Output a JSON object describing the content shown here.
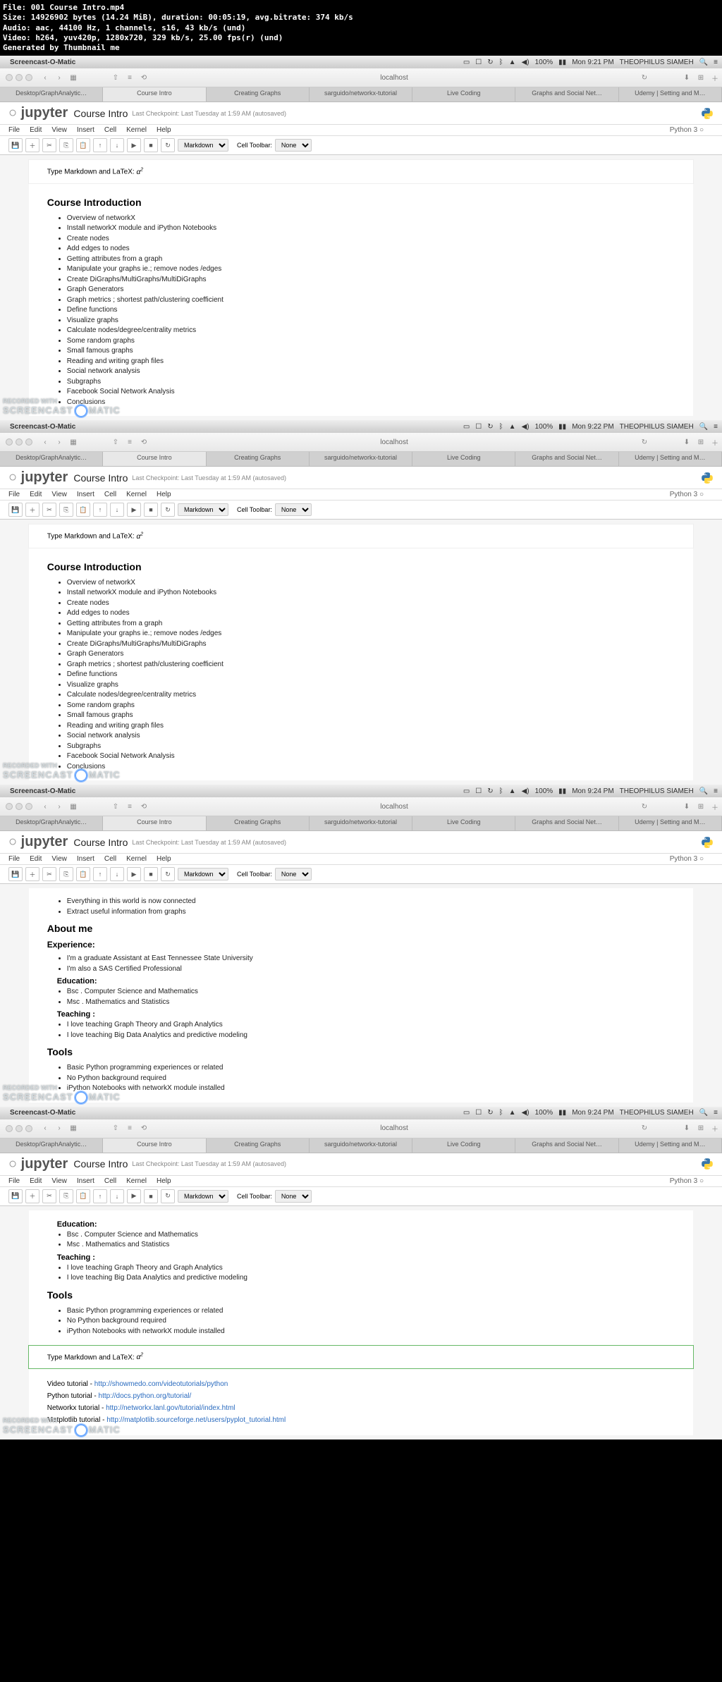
{
  "meta": {
    "l1": "File: 001 Course Intro.mp4",
    "l2": "Size: 14926902 bytes (14.24 MiB), duration: 00:05:19, avg.bitrate: 374 kb/s",
    "l3": "Audio: aac, 44100 Hz, 1 channels, s16, 43 kb/s (und)",
    "l4": "Video: h264, yuv420p, 1280x720, 329 kb/s, 25.00 fps(r) (und)",
    "l5": "Generated by Thumbnail me"
  },
  "menubar": {
    "app": "Screencast-O-Matic",
    "user": "THEOPHILUS SIAMEH",
    "battery": "100%"
  },
  "times": [
    "Mon 9:21 PM",
    "Mon 9:22 PM",
    "Mon 9:24 PM",
    "Mon 9:24 PM"
  ],
  "addr": "localhost",
  "tabs": [
    "Desktop/GraphAnalytic…",
    "Course Intro",
    "Creating Graphs",
    "sarguido/networkx-tutorial",
    "Live Coding",
    "Graphs and Social Net…",
    "Udemy | Setting and M…"
  ],
  "notebook": {
    "title": "Course Intro",
    "saved": "Last Checkpoint: Last Tuesday at 1:59 AM (autosaved)",
    "menus": [
      "File",
      "Edit",
      "View",
      "Insert",
      "Cell",
      "Kernel",
      "Help"
    ],
    "kernel": "Python 3",
    "celltype": "Markdown",
    "celltoolbar_lbl": "Cell Toolbar:",
    "celltoolbar": "None",
    "mdcell": "Type Markdown and LaTeX: ",
    "latex_a": "α",
    "latex_sup": "2"
  },
  "intro": {
    "title": "Course Introduction",
    "items": [
      "Overview of networkX",
      "Install networkX module and iPython Notebooks",
      "Create nodes",
      "Add edges to nodes",
      "Getting attributes from a graph",
      "Manipulate your graphs ie.; remove nodes /edges",
      "Create DiGraphs/MultiGraphs/MultiDiGraphs",
      "Graph Generators",
      "Graph metrics ; shortest path/clustering coefficient",
      "Define functions",
      "Visualize graphs",
      "Calculate nodes/degree/centrality metrics",
      "Some random graphs",
      "Small famous graphs",
      "Reading and writing graph files",
      "Social network analysis",
      "Subgraphs",
      "Facebook Social Network Analysis",
      "Conclusions"
    ]
  },
  "panel3": {
    "pre": [
      "Everything in this world is now connected",
      "Extract useful information from graphs"
    ],
    "about": "About me",
    "exp_h": "Experience:",
    "exp": [
      "I'm a graduate Assistant at East Tennessee State University",
      "I'm also a SAS Certified Professional"
    ],
    "edu_h": "Education:",
    "edu": [
      "Bsc . Computer Science and Mathematics",
      "Msc . Mathematics and Statistics"
    ],
    "teach_h": "Teaching :",
    "teach": [
      "I love teaching Graph Theory and Graph Analytics",
      "I love teaching Big Data Analytics and predictive modeling"
    ],
    "tools_h": "Tools",
    "tools": [
      "Basic Python programming experiences or related",
      "No Python background required",
      "iPython Notebooks with networkX module installed"
    ]
  },
  "links": {
    "video_lbl": "Video tutorial - ",
    "video": "http://showmedo.com/videotutorials/python",
    "python_lbl": "Python tutorial - ",
    "python": "http://docs.python.org/tutorial/",
    "networkx_lbl": "Networkx tutorial - ",
    "networkx": "http://networkx.lanl.gov/tutorial/index.html",
    "mpl_lbl": "Matplotlib tutorial - ",
    "mpl": "http://matplotlib.sourceforge.net/users/pyplot_tutorial.html"
  },
  "watermark": {
    "l1": "RECORDED WITH",
    "l2": "SCREENCAST",
    "l3": "MATIC"
  }
}
